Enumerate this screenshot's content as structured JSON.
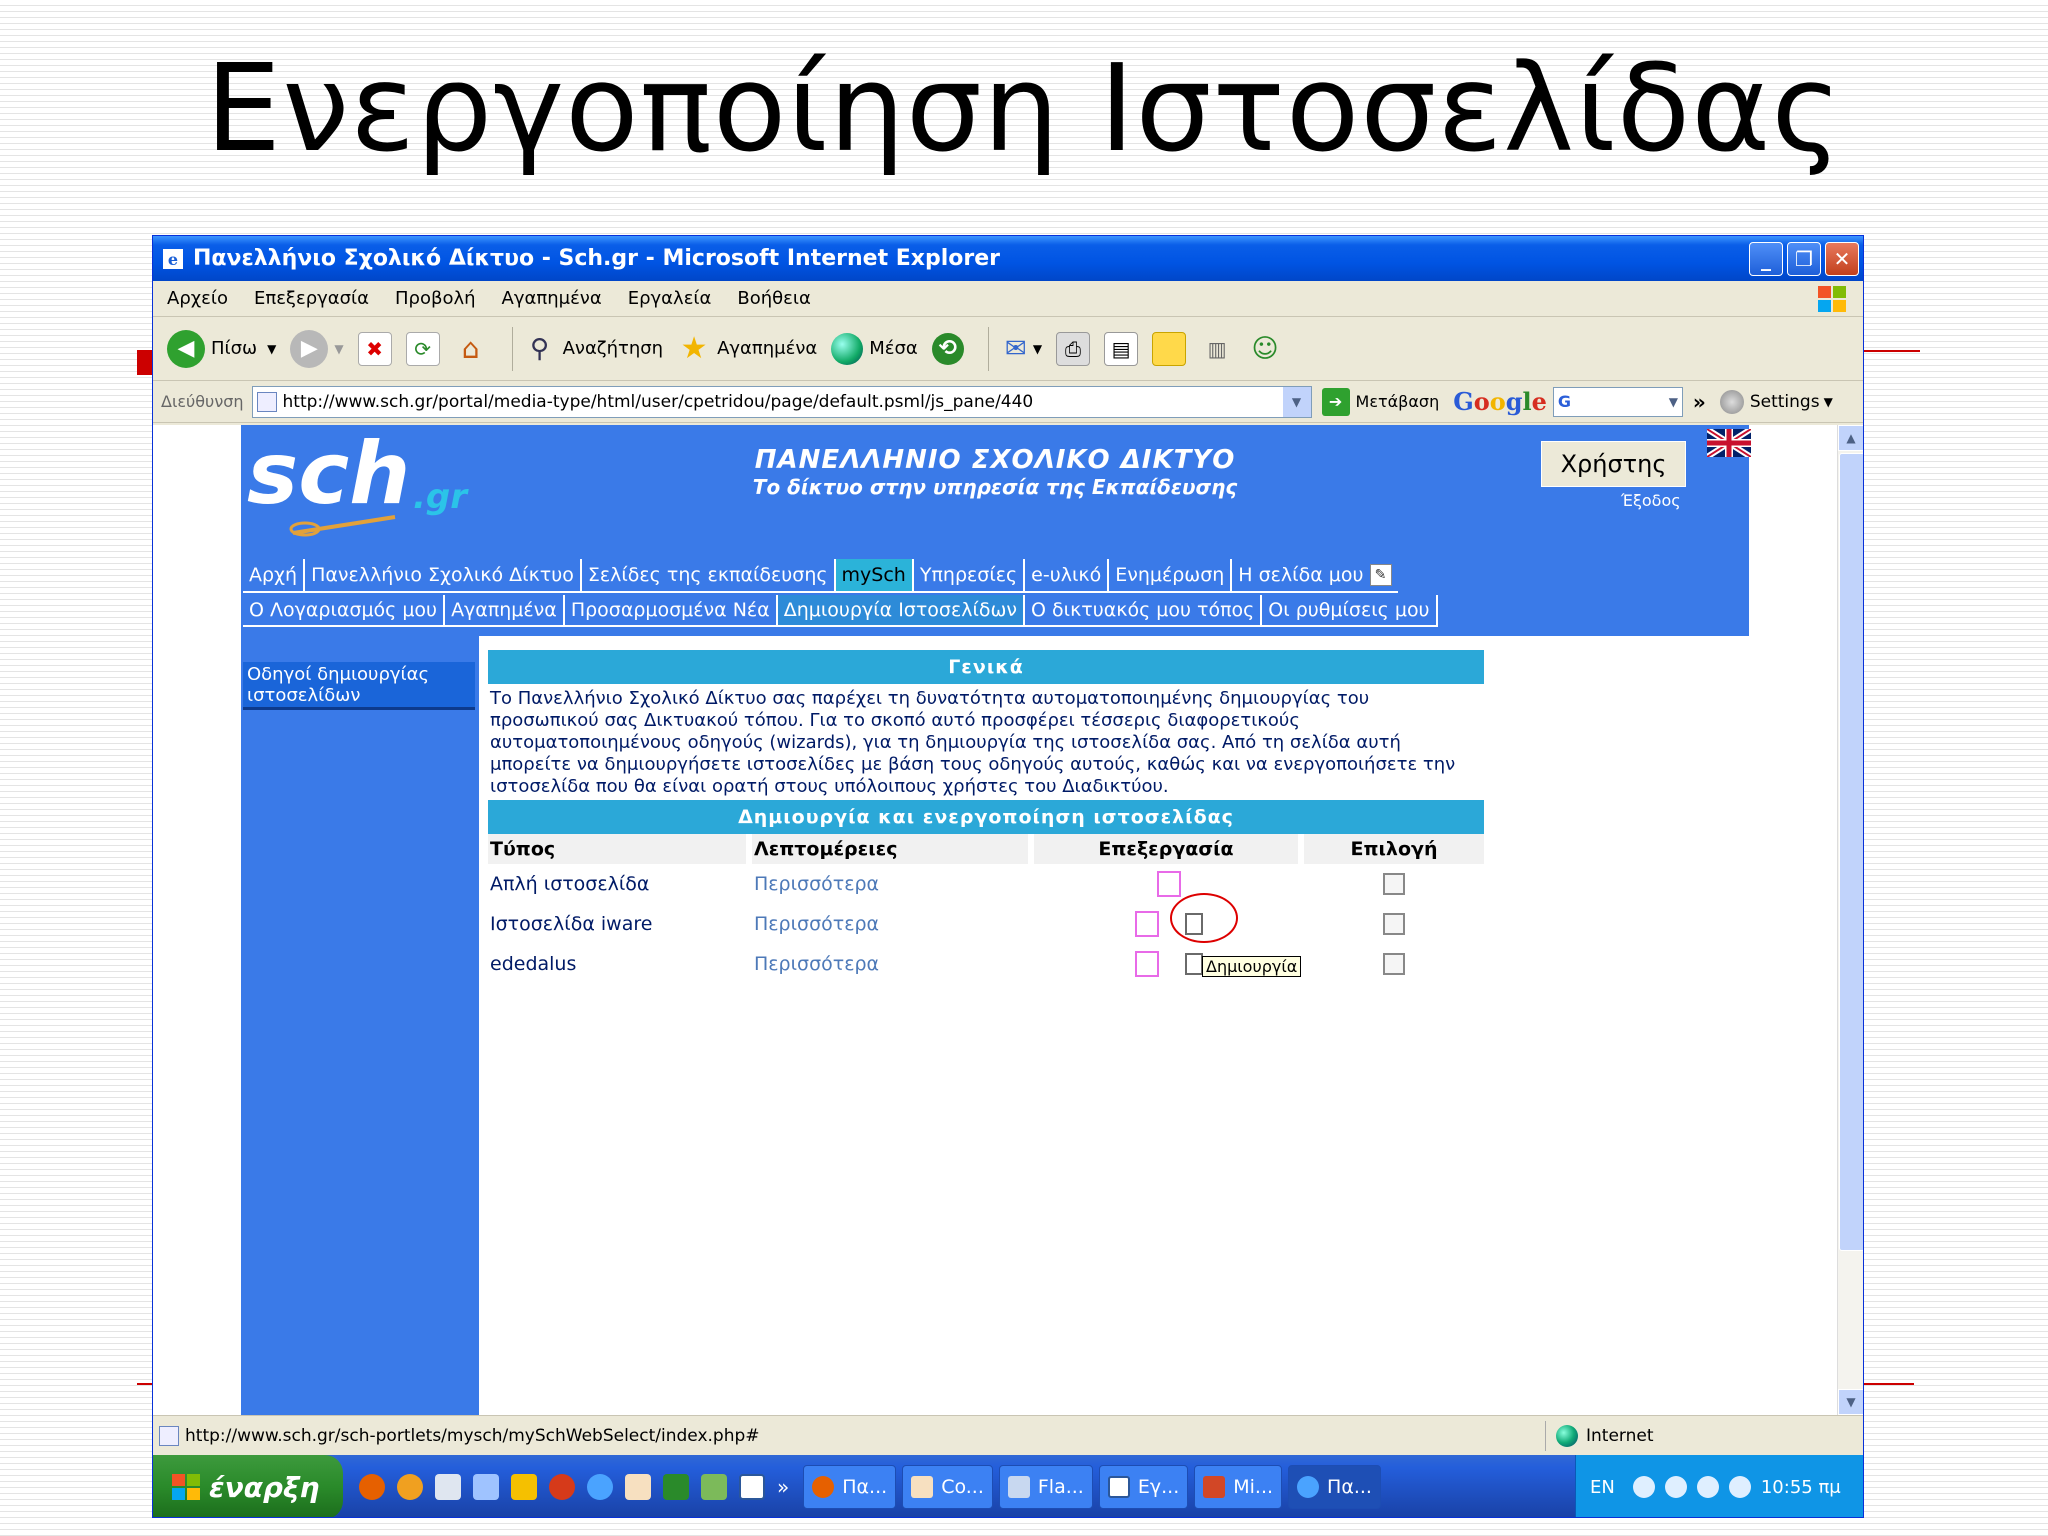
{
  "slide": {
    "title": "Ενεργοποίηση  Ιστοσελίδας"
  },
  "window": {
    "title": "Πανελλήνιο Σχολικό Δίκτυο - Sch.gr - Microsoft Internet Explorer",
    "buttons": {
      "minimize": "_",
      "maximize": "❐",
      "close": "✕"
    }
  },
  "menubar": {
    "items": [
      "Αρχείο",
      "Επεξεργασία",
      "Προβολή",
      "Αγαπημένα",
      "Εργαλεία",
      "Βοήθεια"
    ]
  },
  "toolbar": {
    "back_label": "Πίσω",
    "search_label": "Αναζήτηση",
    "favorites_label": "Αγαπημένα",
    "media_label": "Μέσα"
  },
  "addressbar": {
    "label": "Διεύθυνση",
    "url": "http://www.sch.gr/portal/media-type/html/user/cpetridou/page/default.psml/js_pane/440",
    "go_label": "Μετάβαση",
    "google": "Google",
    "google_select": "G",
    "chevron": "»",
    "settings_label": "Settings"
  },
  "site": {
    "logo_text": "sch",
    "logo_suffix": ".gr",
    "title": "ΠΑΝΕΛΛΗΝΙΟ ΣΧΟΛΙΚΟ ΔΙΚΤΥΟ",
    "subtitle": "Το δίκτυο στην υπηρεσία της Εκπαίδευσης",
    "user_label": "Χρήστης",
    "exit_label": "Έξοδος",
    "nav1": [
      "Αρχή",
      "Πανελλήνιο Σχολικό Δίκτυο",
      "Σελίδες της εκπαίδευσης",
      "mySch",
      "Υπηρεσίες",
      "e-υλικό",
      "Ενημέρωση",
      "Η σελίδα μου"
    ],
    "nav1_active": "mySch",
    "nav2": [
      "Ο Λογαριασμός μου",
      "Αγαπημένα",
      "Προσαρμοσμένα Νέα",
      "Δημιουργία Ιστοσελίδων",
      "Ο δικτυακός μου τόπος",
      "Οι ρυθμίσεις μου"
    ],
    "nav2_active": "Δημιουργία Ιστοσελίδων",
    "sidebar_item": "Οδηγοί δημιουργίας ιστοσελίδων",
    "general_header": "Γενικά",
    "description": "Το Πανελλήνιο Σχολικό Δίκτυο σας παρέχει τη δυνατότητα αυτοματοποιημένης δημιουργίας του προσωπικού σας Δικτυακού τόπου. Για το σκοπό αυτό προσφέρει τέσσερις διαφορετικούς αυτοματοποιημένους οδηγούς (wizards), για τη δημιουργία της ιστοσελίδα σας. Από τη σελίδα αυτή μπορείτε να δημιουργήσετε ιστοσελίδες με βάση τους οδηγούς αυτούς, καθώς και να ενεργοποιήσετε την ιστοσελίδα που θα είναι ορατή στους υπόλοιπους χρήστες του Διαδικτύου.",
    "table_header": "Δημιουργία και ενεργοποίηση ιστοσελίδας",
    "columns": [
      "Τύπος",
      "Λεπτομέρειες",
      "Επεξεργασία",
      "Επιλογή"
    ],
    "rows": [
      {
        "type": "Απλή ιστοσελίδα",
        "details": "Περισσότερα"
      },
      {
        "type": "Ιστοσελίδα iware",
        "details": "Περισσότερα"
      },
      {
        "type": "ededalus",
        "details": "Περισσότερα"
      }
    ],
    "tooltip": "Δημιουργία"
  },
  "statusbar": {
    "url": "http://www.sch.gr/sch-portlets/mysch/mySchWebSelect/index.php#",
    "zone": "Internet"
  },
  "taskbar": {
    "start_label": "έναρξη",
    "chevron": "»",
    "tasks": [
      "Πα...",
      "Co...",
      "Fla...",
      "Εγ...",
      "Mi...",
      "Πα..."
    ],
    "active_task": 5,
    "lang": "EN",
    "clock": "10:55 πμ"
  },
  "colors": {
    "site_blue": "#3a7ae8",
    "header_cyan": "#2ba8d8",
    "xp_blue": "#0054e3",
    "accent_red": "#cc0000"
  }
}
